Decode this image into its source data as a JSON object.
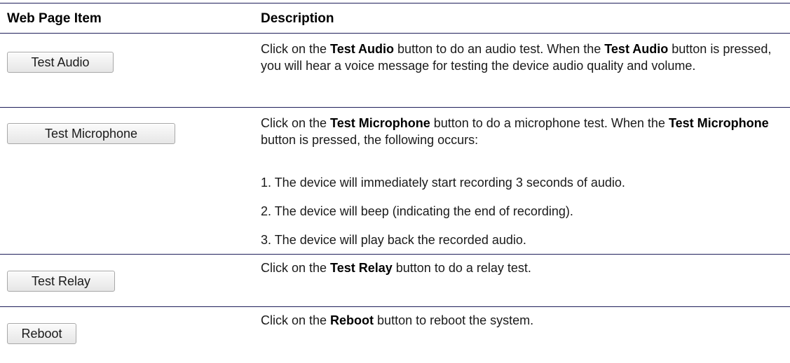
{
  "header": {
    "col_item": "Web Page Item",
    "col_description": "Description"
  },
  "rows": [
    {
      "button_label": "Test Audio",
      "description": {
        "pre": "Click on the ",
        "bold1": "Test Audio",
        "mid": " button to do an audio test. When the ",
        "bold2": "Test Audio",
        "post": " button is pressed, you will hear a voice message for testing the device audio quality and volume."
      }
    },
    {
      "button_label": "Test Microphone",
      "description": {
        "pre": "Click on the ",
        "bold1": "Test Microphone",
        "mid": " button to do a microphone test. When the ",
        "bold2": "Test Microphone",
        "post": " button is pressed, the following occurs:"
      },
      "steps": [
        "1. The device will immediately start recording 3 seconds of audio.",
        "2. The device will beep (indicating the end of recording).",
        "3. The device will play back the recorded audio."
      ]
    },
    {
      "button_label": "Test Relay",
      "description": {
        "pre": "Click on the ",
        "bold1": "Test Relay",
        "post": " button to do a relay test."
      }
    },
    {
      "button_label": "Reboot",
      "description": {
        "pre": "Click on the ",
        "bold1": "Reboot",
        "post": " button to reboot the system."
      }
    }
  ]
}
